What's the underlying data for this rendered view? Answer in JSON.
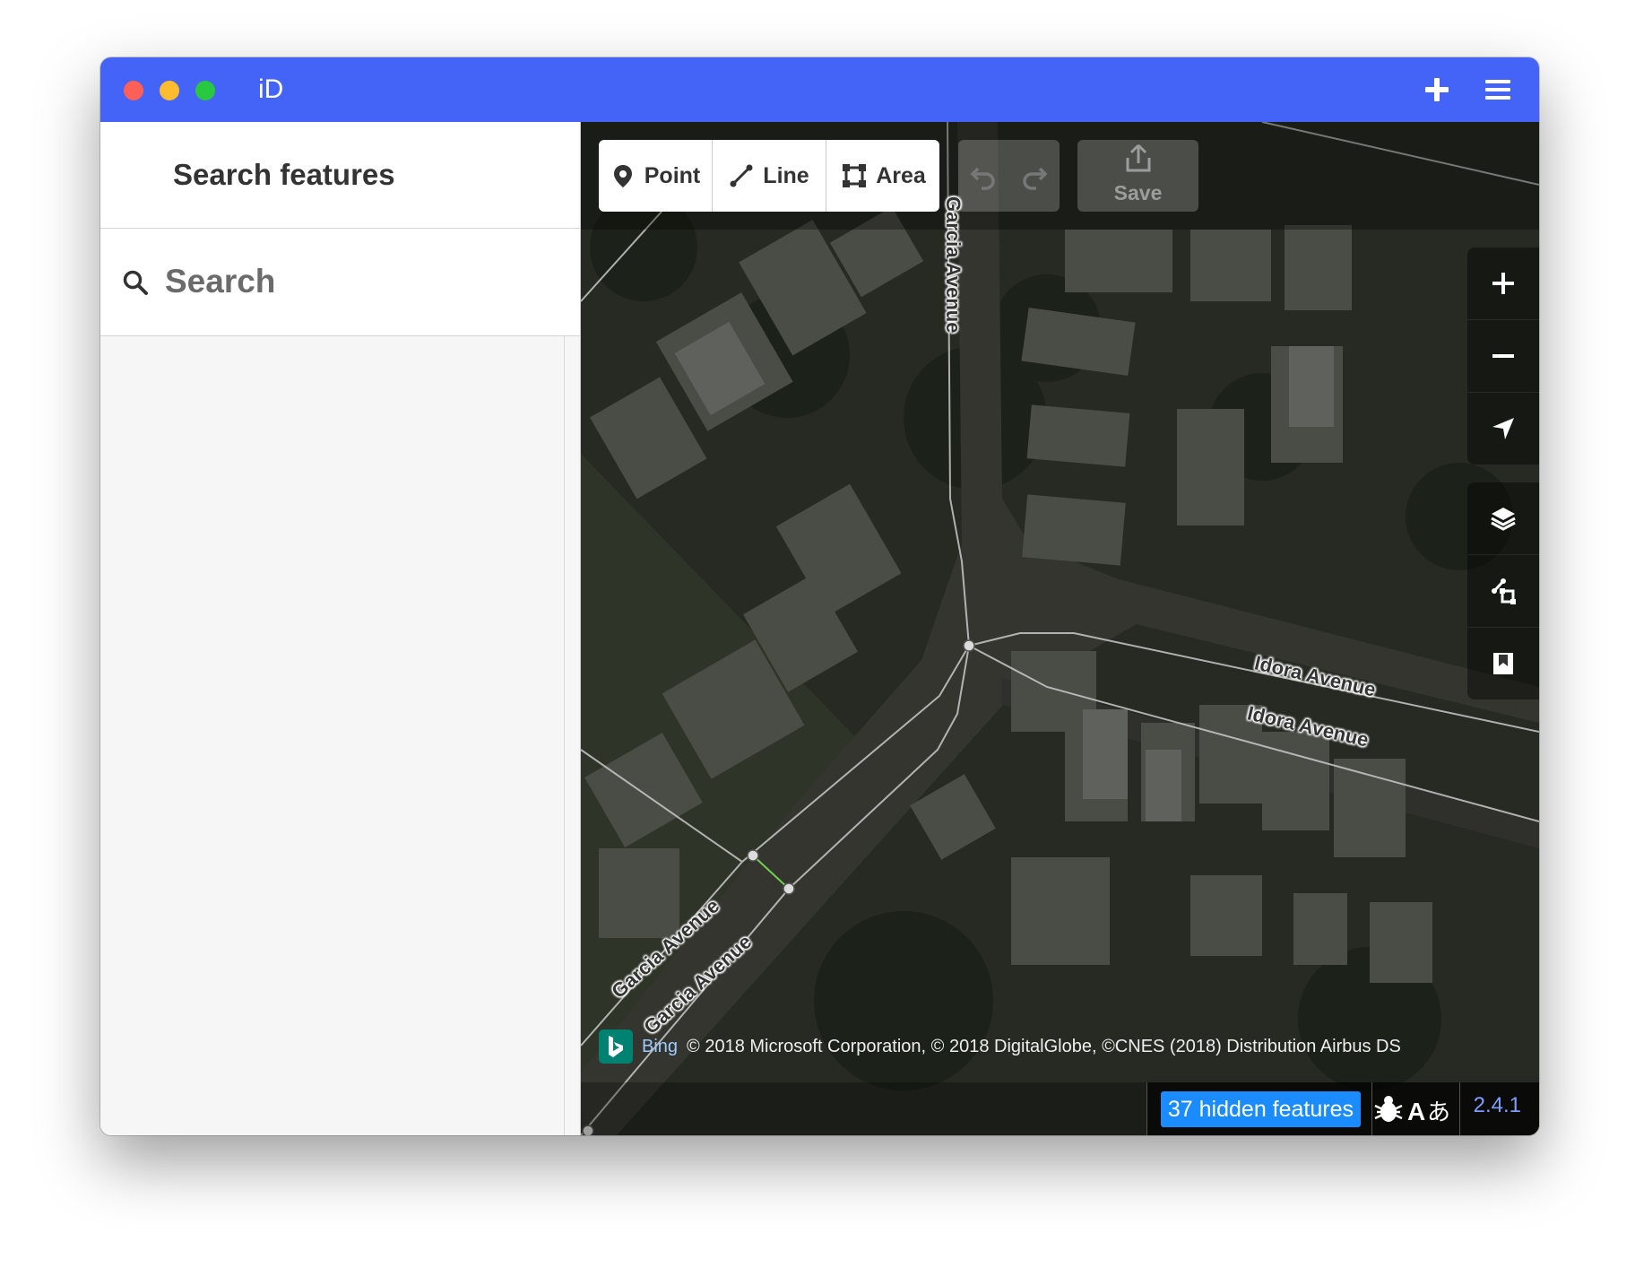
{
  "window": {
    "title": "iD",
    "colors": {
      "titlebar": "#4464f7",
      "close": "#fe5f57",
      "minimize": "#febc2e",
      "zoom": "#28c840"
    },
    "icons": [
      "plus-icon",
      "hamburger-menu-icon"
    ]
  },
  "sidebar": {
    "title": "Search features",
    "search": {
      "placeholder": "Search",
      "value": "",
      "icon": "search-icon"
    }
  },
  "toolbar": {
    "modes": [
      {
        "label": "Point",
        "icon": "map-marker-icon"
      },
      {
        "label": "Line",
        "icon": "line-icon"
      },
      {
        "label": "Area",
        "icon": "area-icon"
      }
    ],
    "undo_icon": "undo-icon",
    "redo_icon": "redo-icon",
    "save": {
      "label": "Save",
      "icon": "upload-icon"
    }
  },
  "map_controls": [
    "zoom-in-icon",
    "zoom-out-icon",
    "geolocate-icon",
    "layers-icon",
    "map-data-icon",
    "issues-icon"
  ],
  "map": {
    "road_labels": [
      "Garcia Avenue",
      "Idora Avenue",
      "Idora Avenue",
      "Garcia Avenue",
      "Garcia Avenue"
    ],
    "attribution": {
      "provider": "Bing",
      "text": "© 2018 Microsoft Corporation, © 2018 DigitalGlobe, ©CNES (2018) Distribution Airbus DS"
    }
  },
  "footer": {
    "hidden_features": "37 hidden features",
    "version": "2.4.1",
    "icons": [
      "bug-icon",
      "translate-icon"
    ],
    "badge_color": "#1a8cff"
  }
}
